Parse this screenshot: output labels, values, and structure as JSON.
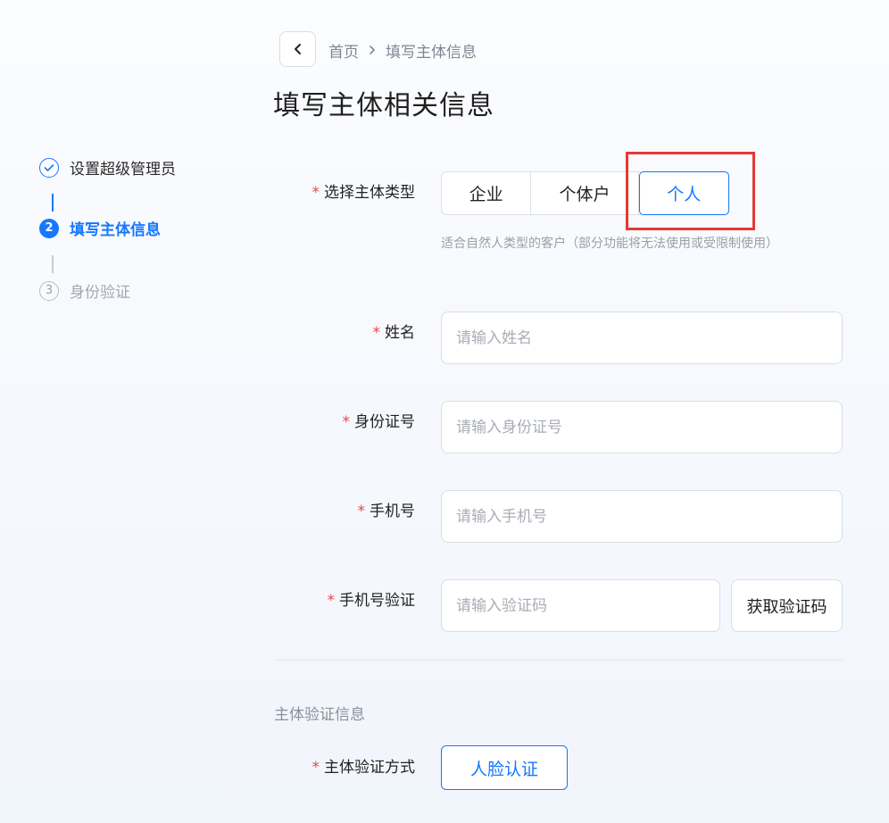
{
  "header": {
    "breadcrumb": [
      "首页",
      "填写主体信息"
    ],
    "title": "填写主体相关信息"
  },
  "steps": [
    {
      "number": "",
      "label": "设置超级管理员",
      "status": "done"
    },
    {
      "number": "2",
      "label": "填写主体信息",
      "status": "active"
    },
    {
      "number": "3",
      "label": "身份验证",
      "status": "pending"
    }
  ],
  "form": {
    "required_mark": "*",
    "entity_type": {
      "label": "选择主体类型",
      "options": [
        "企业",
        "个体户",
        "个人"
      ],
      "selected": "个人",
      "hint": "适合自然人类型的客户（部分功能将无法使用或受限制使用）"
    },
    "name": {
      "label": "姓名",
      "placeholder": "请输入姓名",
      "value": ""
    },
    "id_number": {
      "label": "身份证号",
      "placeholder": "请输入身份证号",
      "value": ""
    },
    "phone": {
      "label": "手机号",
      "placeholder": "请输入手机号",
      "value": ""
    },
    "phone_verify": {
      "label": "手机号验证",
      "placeholder": "请输入验证码",
      "value": "",
      "button": "获取验证码"
    },
    "verification_section": {
      "title": "主体验证信息",
      "method_label": "主体验证方式",
      "method_button": "人脸认证"
    }
  },
  "colors": {
    "accent": "#1677ff",
    "highlight": "#e53935",
    "required": "#e5484d"
  }
}
